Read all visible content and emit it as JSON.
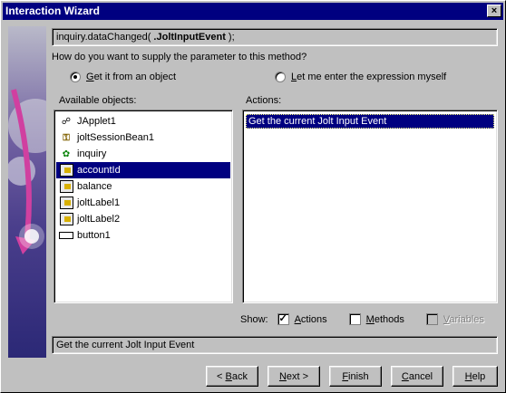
{
  "window": {
    "title": "Interaction Wizard",
    "close_glyph": "×"
  },
  "method": {
    "prefix": "inquiry.dataChanged( ",
    "param": ".JoltInputEvent",
    "suffix": " );"
  },
  "question": "How do you want to supply the parameter to this method?",
  "source_options": [
    {
      "mnemonic": "G",
      "rest": "et it from an object",
      "selected": true
    },
    {
      "mnemonic": "L",
      "rest": "et me enter the expression myself",
      "selected": false
    }
  ],
  "available_objects": {
    "label": "Available objects:",
    "items": [
      {
        "label": "JApplet1",
        "icon": "applet-icon",
        "selected": false
      },
      {
        "label": "joltSessionBean1",
        "icon": "bean-key-icon",
        "selected": false
      },
      {
        "label": "inquiry",
        "icon": "gear-icon",
        "selected": false
      },
      {
        "label": "accountId",
        "icon": "textfield-component-icon",
        "selected": true
      },
      {
        "label": "balance",
        "icon": "textfield-component-icon",
        "selected": false
      },
      {
        "label": "joltLabel1",
        "icon": "label-component-icon",
        "selected": false
      },
      {
        "label": "joltLabel2",
        "icon": "label-component-icon",
        "selected": false
      },
      {
        "label": "button1",
        "icon": "button-component-icon",
        "selected": false
      }
    ]
  },
  "actions": {
    "label": "Actions:",
    "items": [
      {
        "label": "Get the current Jolt Input Event",
        "selected": true
      }
    ]
  },
  "show": {
    "label": "Show:",
    "options": [
      {
        "mnemonic": "A",
        "rest": "ctions",
        "checked": true,
        "enabled": true
      },
      {
        "mnemonic": "M",
        "rest": "ethods",
        "checked": false,
        "enabled": true
      },
      {
        "mnemonic": "V",
        "rest": "ariables",
        "checked": false,
        "enabled": false
      }
    ]
  },
  "status_text": "Get the current Jolt Input Event",
  "buttons": {
    "back": {
      "pre": "< ",
      "mnemonic": "B",
      "rest": "ack"
    },
    "next": {
      "pre": "",
      "mnemonic": "N",
      "rest": "ext >"
    },
    "finish": {
      "pre": "",
      "mnemonic": "F",
      "rest": "inish"
    },
    "cancel": {
      "pre": "",
      "mnemonic": "C",
      "rest": "ancel"
    },
    "help": {
      "pre": "",
      "mnemonic": "H",
      "rest": "elp"
    }
  },
  "colors": {
    "title_bar": "#000080",
    "face": "#c0c0c0",
    "selection": "#000080"
  }
}
